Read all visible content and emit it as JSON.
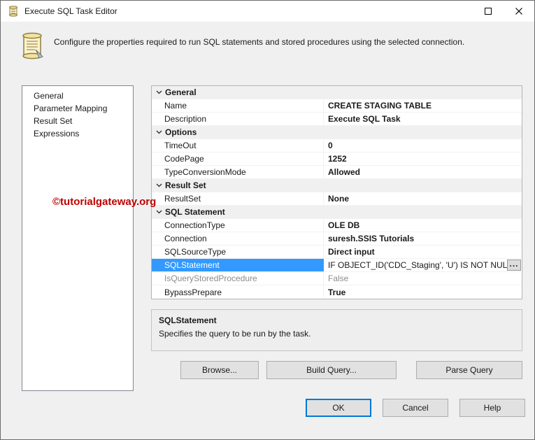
{
  "window": {
    "title": "Execute SQL Task Editor"
  },
  "header": {
    "description": "Configure the properties required to run SQL statements and stored procedures using the selected connection."
  },
  "sidebar": {
    "items": [
      {
        "label": "General",
        "selected": true
      },
      {
        "label": "Parameter Mapping",
        "selected": false
      },
      {
        "label": "Result Set",
        "selected": false
      },
      {
        "label": "Expressions",
        "selected": false
      }
    ]
  },
  "watermark": {
    "text": "©tutorialgateway.org",
    "color": "#c00000"
  },
  "grid": {
    "ellipsis_label": "...",
    "groups": [
      {
        "label": "General",
        "rows": [
          {
            "name": "Name",
            "value": "CREATE STAGING TABLE"
          },
          {
            "name": "Description",
            "value": "Execute SQL Task"
          }
        ]
      },
      {
        "label": "Options",
        "rows": [
          {
            "name": "TimeOut",
            "value": "0"
          },
          {
            "name": "CodePage",
            "value": "1252"
          },
          {
            "name": "TypeConversionMode",
            "value": "Allowed"
          }
        ]
      },
      {
        "label": "Result Set",
        "rows": [
          {
            "name": "ResultSet",
            "value": "None"
          }
        ]
      },
      {
        "label": "SQL Statement",
        "rows": [
          {
            "name": "ConnectionType",
            "value": "OLE DB"
          },
          {
            "name": "Connection",
            "value": "suresh.SSIS Tutorials"
          },
          {
            "name": "SQLSourceType",
            "value": "Direct input"
          },
          {
            "name": "SQLStatement",
            "value": "IF OBJECT_ID('CDC_Staging', 'U') IS NOT NULL",
            "selected": true,
            "has_ellipsis": true
          },
          {
            "name": "IsQueryStoredProcedure",
            "value": "False",
            "disabled": true
          },
          {
            "name": "BypassPrepare",
            "value": "True"
          }
        ]
      }
    ]
  },
  "description_panel": {
    "title": "SQLStatement",
    "text": "Specifies the query to be run by the task."
  },
  "query_buttons": {
    "browse": "Browse...",
    "build": "Build Query...",
    "parse": "Parse Query"
  },
  "footer_buttons": {
    "ok": "OK",
    "cancel": "Cancel",
    "help": "Help"
  },
  "icons": {
    "app_icon": "sql-task-scroll",
    "maximize_icon": "maximize-square",
    "close_icon": "close-x",
    "category_icon": "chevron-down"
  },
  "colors": {
    "selection": "#3399ff",
    "default_button_border": "#0078d7",
    "watermark": "#c00000"
  }
}
